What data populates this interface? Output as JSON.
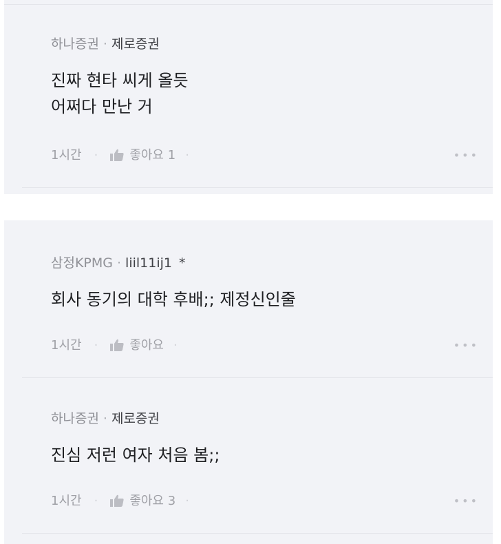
{
  "comments": [
    {
      "company": "하나증권",
      "separator": "·",
      "user": "제로증권",
      "star": "",
      "lines": [
        "진짜 현타 씨게 올듯",
        "어쩌다 만난 거"
      ],
      "time": "1시간",
      "like_label": "좋아요",
      "like_count": "1"
    },
    {
      "company": "삼정KPMG",
      "separator": "·",
      "user": "liil11ij1",
      "star": "*",
      "lines": [
        "회사 동기의 대학 후배;; 제정신인줄"
      ],
      "time": "1시간",
      "like_label": "좋아요",
      "like_count": ""
    },
    {
      "company": "하나증권",
      "separator": "·",
      "user": "제로증권",
      "star": "",
      "lines": [
        "진심 저런 여자 처음 봄;;"
      ],
      "time": "1시간",
      "like_label": "좋아요",
      "like_count": "3"
    }
  ],
  "ui": {
    "dot_separator": "·",
    "more_glyph": "•••",
    "like_icon": "thumbs-up-icon",
    "more_icon": "more-options-icon"
  },
  "colors": {
    "card_bg": "#f2f3f7",
    "divider": "#e4e5ea",
    "meta_text": "#8e8f96",
    "user_text": "#3f4045",
    "body_text": "#1e1f22",
    "action_text": "#9fa0a6"
  }
}
